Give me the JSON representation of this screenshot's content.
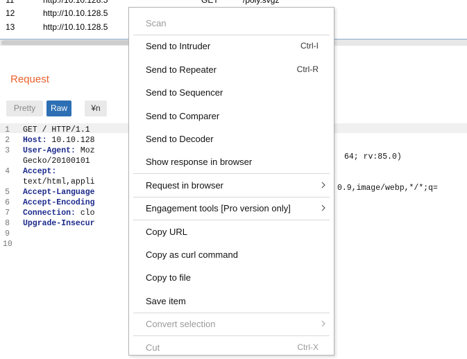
{
  "table": {
    "rows": [
      {
        "num": "11",
        "url": "http://10.10.128.5",
        "c3": "GET",
        "c4": "/poly.svgz"
      },
      {
        "num": "12",
        "url": "http://10.10.128.5"
      },
      {
        "num": "13",
        "url": "http://10.10.128.5"
      }
    ]
  },
  "request": {
    "title": "Request",
    "tabs": {
      "pretty": "Pretty",
      "raw": "Raw",
      "newline": "¥n"
    },
    "lines": [
      {
        "num": "1",
        "key": "",
        "text": "GET / HTTP/1.1"
      },
      {
        "num": "2",
        "key": "Host:",
        "text": " 10.10.128"
      },
      {
        "num": "3",
        "key": "User-Agent:",
        "text": " Moz"
      },
      {
        "num": "",
        "key": "",
        "text": "Gecko/20100101"
      },
      {
        "num": "4",
        "key": "Accept:",
        "text": ""
      },
      {
        "num": "",
        "key": "",
        "text": "text/html,appli"
      },
      {
        "num": "5",
        "key": "Accept-Language",
        "text": ""
      },
      {
        "num": "6",
        "key": "Accept-Encoding",
        "text": ""
      },
      {
        "num": "7",
        "key": "Connection:",
        "text": " clo"
      },
      {
        "num": "8",
        "key": "Upgrade-Insecur",
        "text": ""
      },
      {
        "num": "9",
        "key": "",
        "text": ""
      },
      {
        "num": "10",
        "key": "",
        "text": ""
      }
    ],
    "ua_tail": "64; rv:85.0)",
    "accept_tail": "0.9,image/webp,*/*;q="
  },
  "menu": {
    "items": [
      {
        "label": "Scan",
        "shortcut": "",
        "disabled": true,
        "submenu": false
      },
      {
        "label": "Send to Intruder",
        "shortcut": "Ctrl-I",
        "disabled": false,
        "submenu": false
      },
      {
        "label": "Send to Repeater",
        "shortcut": "Ctrl-R",
        "disabled": false,
        "submenu": false
      },
      {
        "label": "Send to Sequencer",
        "shortcut": "",
        "disabled": false,
        "submenu": false
      },
      {
        "label": "Send to Comparer",
        "shortcut": "",
        "disabled": false,
        "submenu": false
      },
      {
        "label": "Send to Decoder",
        "shortcut": "",
        "disabled": false,
        "submenu": false
      },
      {
        "label": "Show response in browser",
        "shortcut": "",
        "disabled": false,
        "submenu": false
      },
      {
        "label": "Request in browser",
        "shortcut": "",
        "disabled": false,
        "submenu": true
      },
      {
        "label": "Engagement tools [Pro version only]",
        "shortcut": "",
        "disabled": false,
        "submenu": true
      },
      {
        "label": "Copy URL",
        "shortcut": "",
        "disabled": false,
        "submenu": false
      },
      {
        "label": "Copy as curl command",
        "shortcut": "",
        "disabled": false,
        "submenu": false
      },
      {
        "label": "Copy to file",
        "shortcut": "",
        "disabled": false,
        "submenu": false
      },
      {
        "label": "Save item",
        "shortcut": "",
        "disabled": false,
        "submenu": false
      },
      {
        "label": "Convert selection",
        "shortcut": "",
        "disabled": true,
        "submenu": true
      },
      {
        "label": "Cut",
        "shortcut": "Ctrl-X",
        "disabled": true,
        "submenu": false
      }
    ]
  },
  "colors": {
    "accent": "#e8612c",
    "raw_button": "#2d6fb4",
    "key_text": "#1c2a8c"
  }
}
